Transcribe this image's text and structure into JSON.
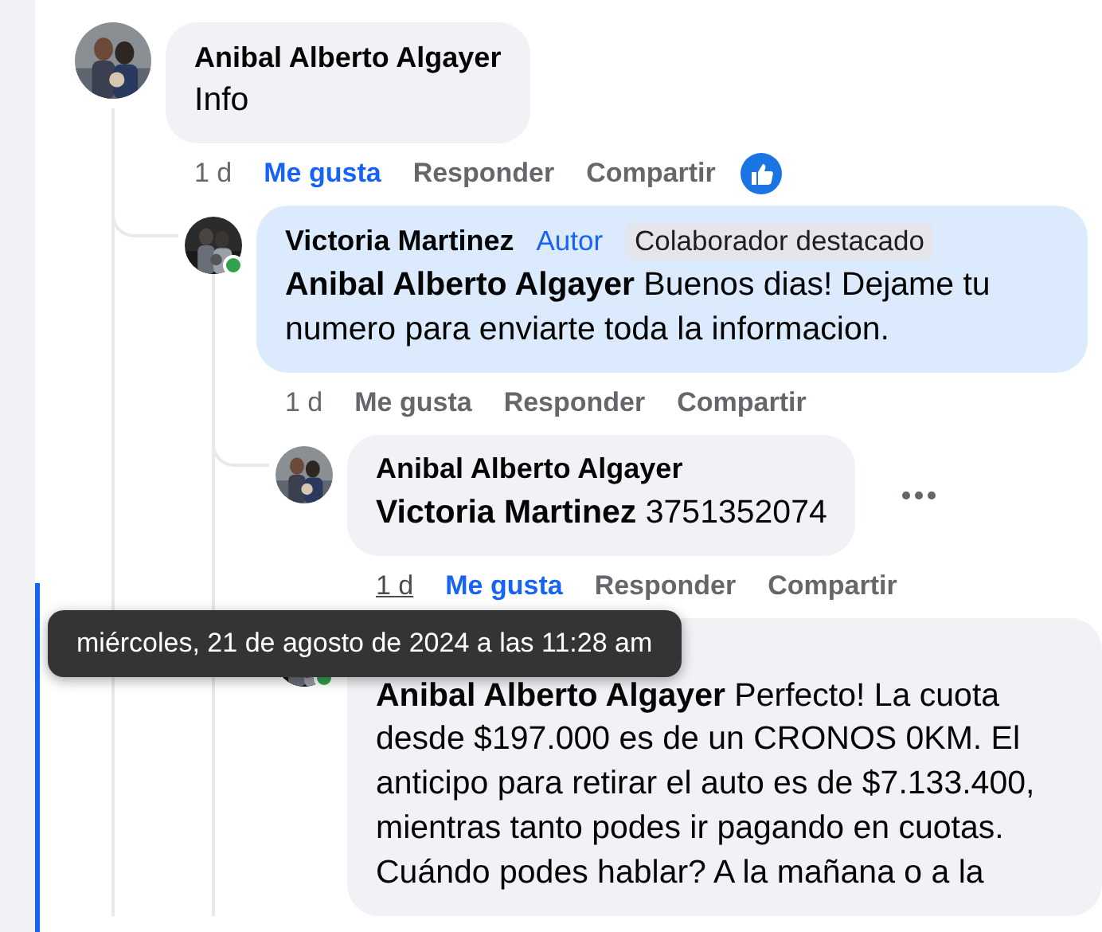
{
  "comments": [
    {
      "author": "Anibal Alberto Algayer",
      "text": "Info",
      "time": "1 d",
      "time_hovered": false,
      "actions": [
        {
          "label": "Me gusta",
          "selected": true
        },
        {
          "label": "Responder",
          "selected": false
        },
        {
          "label": "Compartir",
          "selected": false
        }
      ],
      "reacted": true,
      "replies": [
        {
          "author": "Victoria Martinez",
          "online": true,
          "highlighted": true,
          "badges": [
            {
              "label": "Autor",
              "kind": "author"
            },
            {
              "label": "Colaborador destacado",
              "kind": "top"
            }
          ],
          "mention": "Anibal Alberto Algayer",
          "text": "Buenos dias! Dejame tu numero para enviarte toda la informacion.",
          "time": "1 d",
          "time_hovered": false,
          "actions": [
            {
              "label": "Me gusta",
              "selected": false
            },
            {
              "label": "Responder",
              "selected": false
            },
            {
              "label": "Compartir",
              "selected": false
            }
          ],
          "replies": [
            {
              "author": "Anibal Alberto Algayer",
              "mention": "Victoria Martinez",
              "text": "3751352074",
              "time": "1 d",
              "time_hovered": true,
              "actions": [
                {
                  "label": "Me gusta",
                  "selected": true
                },
                {
                  "label": "Responder",
                  "selected": false
                },
                {
                  "label": "Compartir",
                  "selected": false
                }
              ],
              "more_menu": true
            },
            {
              "online": true,
              "mention": "Anibal Alberto Algayer",
              "text": "Perfecto! La cuota desde $197.000 es de un CRONOS 0KM. El anticipo para retirar el auto es de $7.133.400, mientras tanto podes ir pagando en cuotas. Cuándo podes hablar? A la mañana o a la"
            }
          ]
        }
      ]
    }
  ],
  "tooltip": "miércoles, 21 de agosto de 2024 a las 11:28 am"
}
